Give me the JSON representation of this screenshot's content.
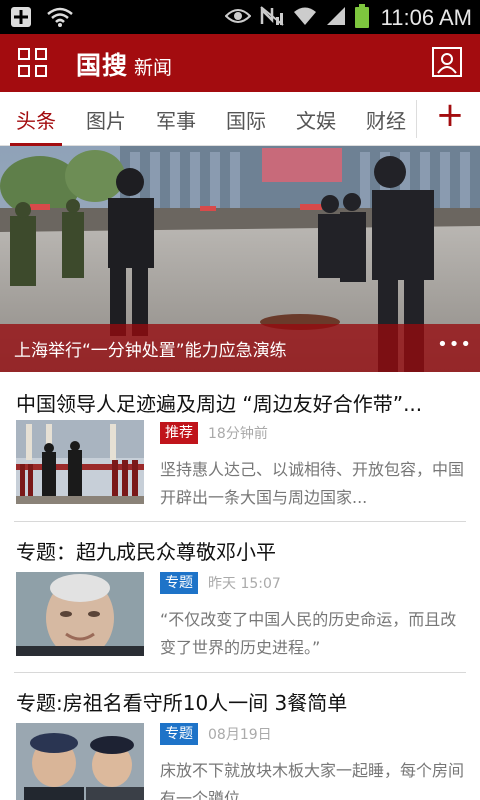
{
  "status_bar": {
    "time": "11:06 AM"
  },
  "header": {
    "brand": "国搜",
    "subtitle": "新闻"
  },
  "tabs": [
    {
      "label": "头条",
      "active": true
    },
    {
      "label": "图片",
      "active": false
    },
    {
      "label": "军事",
      "active": false
    },
    {
      "label": "国际",
      "active": false
    },
    {
      "label": "文娱",
      "active": false
    },
    {
      "label": "财经",
      "active": false
    }
  ],
  "add_tab_label": "+",
  "hero": {
    "caption": "上海举行“一分钟处置”能力应急演练",
    "more_label": "•••"
  },
  "news": [
    {
      "title": "中国领导人足迹遍及周边 “周边友好合作带”...",
      "badge": "推荐",
      "time": "18分钟前",
      "summary": "坚持惠人达己、以诚相待、开放包容，中国开辟出一条大国与周边国家..."
    },
    {
      "title": "专题：超九成民众尊敬邓小平",
      "badge": "专题",
      "time": "昨天 15:07",
      "summary": "“不仅改变了中国人民的历史命运，而且改变了世界的历史进程。”"
    },
    {
      "title": "专题:房祖名看守所10人一间 3餐简单",
      "badge": "专题",
      "time": "08月19日",
      "summary": "床放不下就放块木板大家一起睡，每个房间有一个蹲位"
    }
  ],
  "colors": {
    "brand": "#a30c0f",
    "badge_recommend": "#c0141b",
    "badge_topic": "#1e73c8"
  }
}
